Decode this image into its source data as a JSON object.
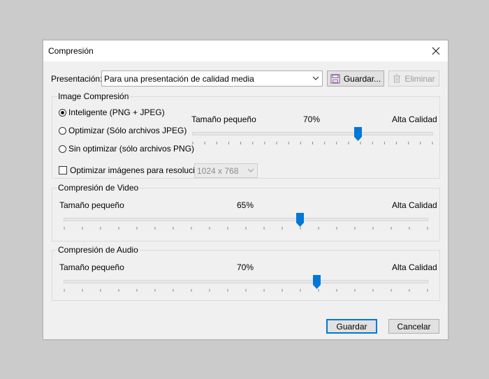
{
  "dialog": {
    "title": "Compresión",
    "close_icon": "close-icon"
  },
  "preset": {
    "label": "Presentación:",
    "selected": "Para una presentación de calidad media",
    "save_label": "Guardar...",
    "delete_label": "Eliminar",
    "save_icon": "floppy-disk-icon",
    "delete_icon": "trash-icon"
  },
  "image_group": {
    "title": "Image Compresión",
    "options": [
      {
        "label": "Inteligente (PNG + JPEG)",
        "checked": true
      },
      {
        "label": "Optimizar (Sólo archivos JPEG)",
        "checked": false
      },
      {
        "label": "Sin optimizar (sólo archivos PNG)",
        "checked": false
      }
    ],
    "resolution_checkbox_label": "Optimizar imágenes para resolución:",
    "resolution_checked": false,
    "resolution_value": "1024 x 768",
    "slider": {
      "min_label": "Tamaño pequeño",
      "value_label": "70%",
      "max_label": "Alta Calidad",
      "value": 70
    }
  },
  "video_group": {
    "title": "Compresión de Video",
    "slider": {
      "min_label": "Tamaño pequeño",
      "value_label": "65%",
      "max_label": "Alta Calidad",
      "value": 65
    }
  },
  "audio_group": {
    "title": "Compresión de Audio",
    "slider": {
      "min_label": "Tamaño pequeño",
      "value_label": "70%",
      "max_label": "Alta Calidad",
      "value": 70
    }
  },
  "footer": {
    "ok_label": "Guardar",
    "cancel_label": "Cancelar"
  },
  "colors": {
    "accent": "#0078d7",
    "dialog_bg": "#f0f0f0",
    "backdrop": "#cbcbcb"
  }
}
